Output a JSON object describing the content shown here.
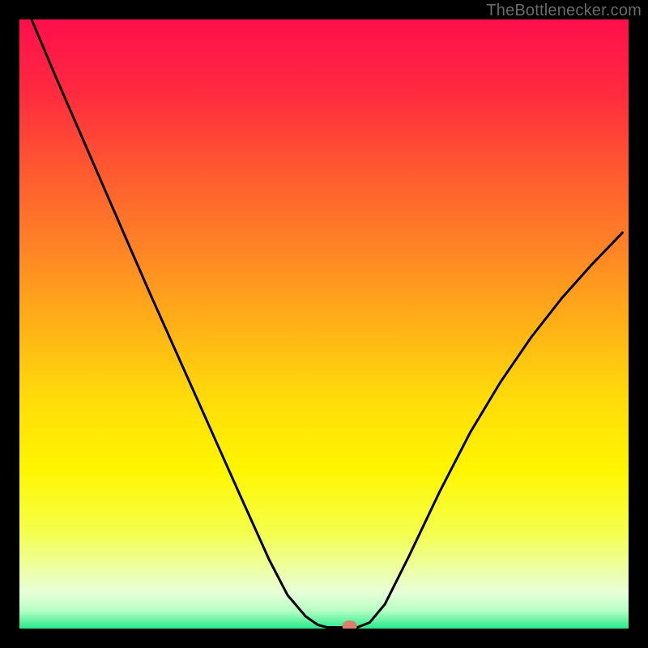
{
  "watermark": "TheBottlenecker.com",
  "chart_data": {
    "type": "line",
    "title": "",
    "xlabel": "",
    "ylabel": "",
    "xlim": [
      0,
      1
    ],
    "ylim": [
      0,
      1
    ],
    "gradient_stops": [
      {
        "offset": 0.0,
        "color": "#ff0f4c"
      },
      {
        "offset": 0.12,
        "color": "#ff2a3f"
      },
      {
        "offset": 0.25,
        "color": "#ff5a30"
      },
      {
        "offset": 0.38,
        "color": "#ff8525"
      },
      {
        "offset": 0.5,
        "color": "#ffb017"
      },
      {
        "offset": 0.62,
        "color": "#ffdb0a"
      },
      {
        "offset": 0.74,
        "color": "#fff600"
      },
      {
        "offset": 0.84,
        "color": "#f4ff4a"
      },
      {
        "offset": 0.9,
        "color": "#edffa0"
      },
      {
        "offset": 0.94,
        "color": "#e8ffd8"
      },
      {
        "offset": 0.97,
        "color": "#b8ffc4"
      },
      {
        "offset": 1.0,
        "color": "#28e98b"
      }
    ],
    "series": [
      {
        "name": "bottleneck-curve",
        "color": "#000000",
        "stroke_width": 3,
        "x": [
          0.02,
          0.06,
          0.11,
          0.16,
          0.21,
          0.26,
          0.31,
          0.36,
          0.41,
          0.44,
          0.47,
          0.49,
          0.505,
          0.52,
          0.555,
          0.575,
          0.6,
          0.64,
          0.69,
          0.74,
          0.79,
          0.84,
          0.89,
          0.94,
          0.99
        ],
        "y": [
          1.0,
          0.905,
          0.79,
          0.675,
          0.56,
          0.448,
          0.336,
          0.224,
          0.113,
          0.055,
          0.02,
          0.006,
          0.002,
          0.002,
          0.002,
          0.01,
          0.04,
          0.12,
          0.225,
          0.322,
          0.405,
          0.478,
          0.542,
          0.598,
          0.65
        ]
      }
    ],
    "marker": {
      "name": "current-config-marker",
      "x": 0.542,
      "y": 0.004,
      "rx": 9,
      "ry": 7,
      "color": "#d97f6c"
    }
  }
}
